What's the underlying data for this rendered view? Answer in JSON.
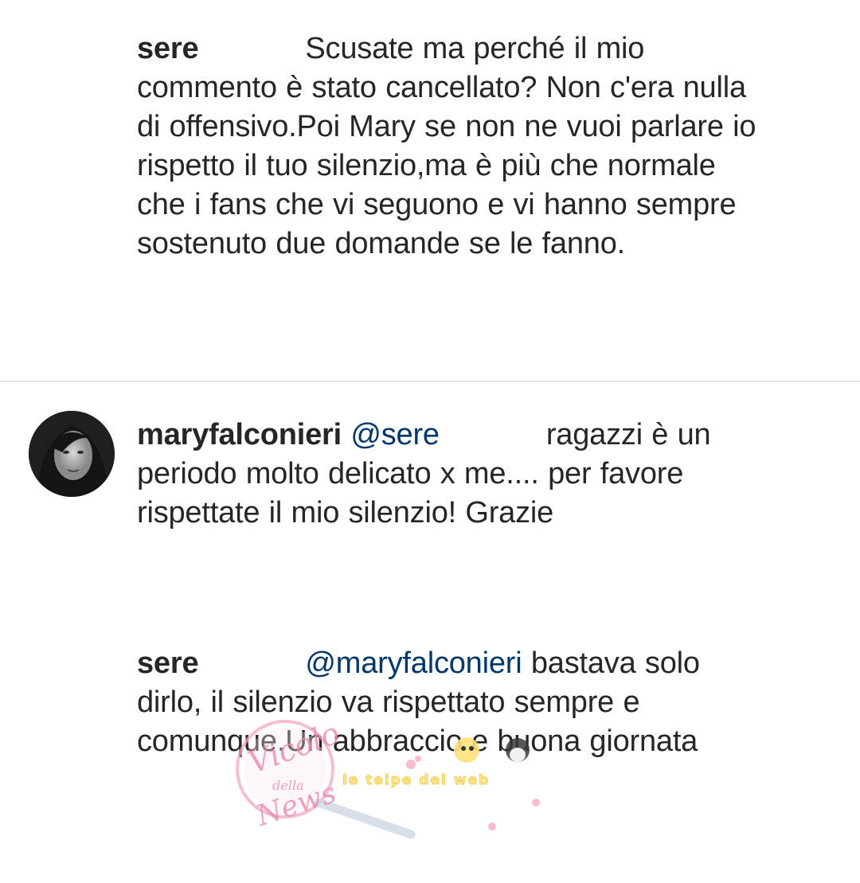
{
  "comments": [
    {
      "username": "sere",
      "text_line1": "Scusate ma perché il mio",
      "text_rest": "commento è stato cancellato? Non c'era nulla di offensivo.Poi Mary se non ne vuoi parlare io rispetto il tuo silenzio,ma è più che normale che i fans che vi seguono e vi hanno sempre sostenuto due domande se le fanno."
    },
    {
      "username": "maryfalconieri",
      "mention": "@sere",
      "text_line1": "ragazzi è un",
      "text_rest": "periodo molto delicato x me.... per favore rispettate il mio silenzio! Grazie"
    },
    {
      "username": "sere",
      "mention": "@maryfalconieri",
      "text_line1": "bastava",
      "text_rest": "solo dirlo, il silenzio va rispettato sempre e comunque.Un abbraccio e buona giornata"
    }
  ],
  "watermark": {
    "script_text": "Vicolo della News",
    "banner_text": "le teipe del web"
  }
}
